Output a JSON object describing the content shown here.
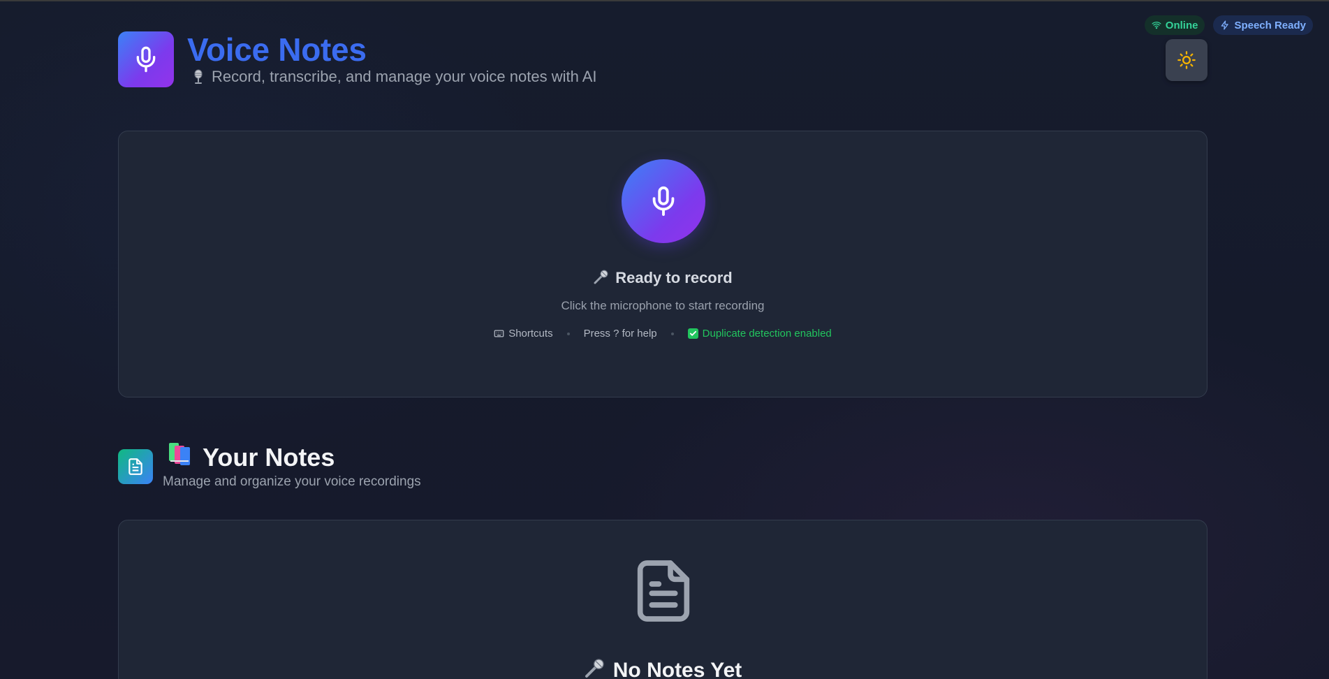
{
  "status": {
    "online_label": "Online",
    "speech_label": "Speech Ready",
    "online_icon": "wifi-icon",
    "speech_icon": "lightning-icon"
  },
  "theme_toggle": {
    "icon": "sun-icon"
  },
  "header": {
    "title": "Voice Notes",
    "subtitle": "Record, transcribe, and manage your voice notes with AI",
    "subtitle_icon": "microphone-emoji",
    "logo_icon": "microphone-icon"
  },
  "recorder": {
    "status": "Ready to record",
    "status_icon": "microphone-emoji",
    "hint": "Click the microphone to start recording",
    "shortcuts_label": "Shortcuts",
    "help_label": "Press ? for help",
    "duplicate_label": "Duplicate detection enabled"
  },
  "notes": {
    "title": "Your Notes",
    "title_icon": "books-emoji",
    "subtitle": "Manage and organize your voice recordings",
    "empty_title": "No Notes Yet",
    "empty_icon": "document-icon"
  },
  "colors": {
    "accent_blue": "#3b6cf0",
    "accent_purple": "#9333ea",
    "success_green": "#22c55e",
    "background": "#151a2b",
    "card": "#1f2636"
  }
}
